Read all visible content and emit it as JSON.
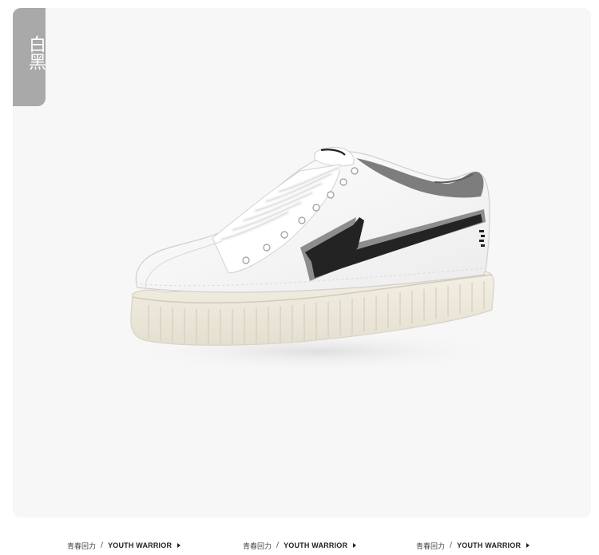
{
  "color_tag": {
    "label": "白黑"
  },
  "footer": {
    "items": [
      {
        "cn": "青春回力",
        "sep": "/",
        "en": "YOUTH WARRIOR"
      },
      {
        "cn": "青春回力",
        "sep": "/",
        "en": "YOUTH WARRIOR"
      },
      {
        "cn": "青春回力",
        "sep": "/",
        "en": "YOUTH WARRIOR"
      }
    ]
  },
  "colors": {
    "tag_bg": "#a9a9a9",
    "card_bg": "#f7f7f7",
    "shoe_upper": "#ffffff",
    "shoe_stripe": "#222222",
    "shoe_collar": "#7a7a7a",
    "sole": "#ece8dc"
  },
  "image": {
    "subject": "white sneaker with black stripe"
  }
}
